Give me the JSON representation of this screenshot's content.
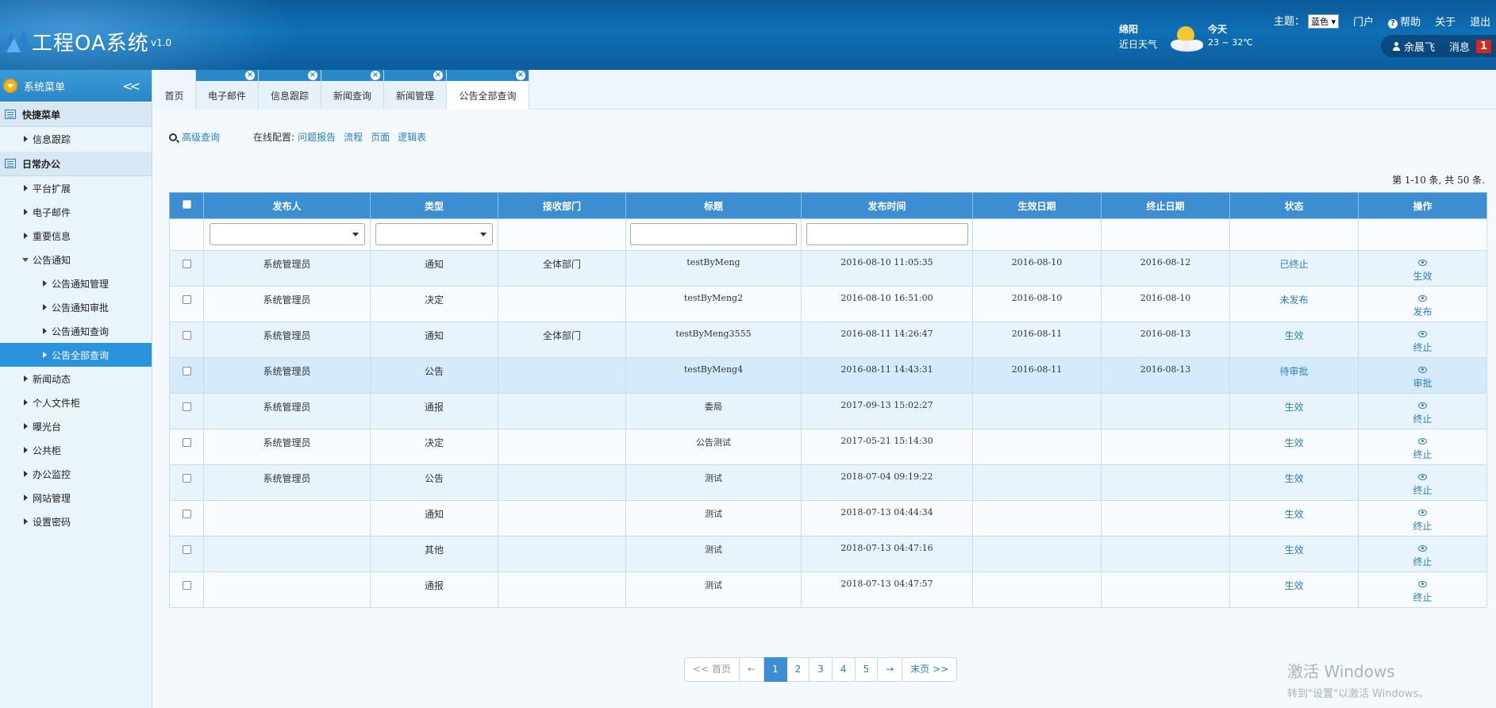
{
  "header": {
    "title": "工程OA系统",
    "version": "v1.0",
    "weather": {
      "city": "绵阳",
      "label": "近日天气",
      "today": "今天",
      "temp": "23 ~ 32℃"
    },
    "theme_label": "主题：",
    "theme_value": "蓝色",
    "nav": {
      "portal": "门户",
      "help": "帮助",
      "about": "关于",
      "logout": "退出"
    },
    "user": {
      "name": "余晨飞",
      "messages_label": "消息",
      "messages_count": "1"
    }
  },
  "sidebar": {
    "title": "系统菜单",
    "collapse": "<<",
    "sections": [
      {
        "label": "快捷菜单",
        "items": [
          {
            "label": "信息跟踪"
          }
        ]
      },
      {
        "label": "日常办公",
        "items": [
          {
            "label": "平台扩展"
          },
          {
            "label": "电子邮件"
          },
          {
            "label": "重要信息"
          },
          {
            "label": "公告通知",
            "expanded": true,
            "children": [
              {
                "label": "公告通知管理"
              },
              {
                "label": "公告通知审批"
              },
              {
                "label": "公告通知查询"
              },
              {
                "label": "公告全部查询",
                "active": true
              }
            ]
          },
          {
            "label": "新闻动态"
          },
          {
            "label": "个人文件柜"
          },
          {
            "label": "曝光台"
          },
          {
            "label": "公共柜"
          },
          {
            "label": "办公监控"
          },
          {
            "label": "网站管理"
          },
          {
            "label": "设置密码"
          }
        ]
      }
    ]
  },
  "tabs": [
    {
      "label": "首页",
      "closable": false
    },
    {
      "label": "电子邮件",
      "closable": true
    },
    {
      "label": "信息跟踪",
      "closable": true
    },
    {
      "label": "新闻查询",
      "closable": true
    },
    {
      "label": "新闻管理",
      "closable": true
    },
    {
      "label": "公告全部查询",
      "closable": true,
      "active": true
    }
  ],
  "toolbar": {
    "advanced_search": "高级查询",
    "online_config_label": "在线配置:",
    "config_links": [
      "问题报告",
      "流程",
      "页面",
      "逻辑表"
    ]
  },
  "count_text": "第 1-10 条, 共 50 条.",
  "table": {
    "columns": [
      "发布人",
      "类型",
      "接收部门",
      "标题",
      "发布时间",
      "生效日期",
      "终止日期",
      "状态",
      "操作"
    ],
    "rows": [
      {
        "publisher": "系统管理员",
        "type": "通知",
        "dept": "全体部门",
        "title": "testByMeng",
        "time": "2016-08-10 11:05:35",
        "start": "2016-08-10",
        "end": "2016-08-12",
        "status": "已终止",
        "action": "生效"
      },
      {
        "publisher": "系统管理员",
        "type": "决定",
        "dept": "",
        "title": "testByMeng2",
        "time": "2016-08-10 16:51:00",
        "start": "2016-08-10",
        "end": "2016-08-10",
        "status": "未发布",
        "action": "发布"
      },
      {
        "publisher": "系统管理员",
        "type": "通知",
        "dept": "全体部门",
        "title": "testByMeng3555",
        "time": "2016-08-11 14:26:47",
        "start": "2016-08-11",
        "end": "2016-08-13",
        "status": "生效",
        "action": "终止"
      },
      {
        "publisher": "系统管理员",
        "type": "公告",
        "dept": "",
        "title": "testByMeng4",
        "time": "2016-08-11 14:43:31",
        "start": "2016-08-11",
        "end": "2016-08-13",
        "status": "待审批",
        "action": "审批"
      },
      {
        "publisher": "系统管理员",
        "type": "通报",
        "dept": "",
        "title": "委局",
        "time": "2017-09-13 15:02:27",
        "start": "",
        "end": "",
        "status": "生效",
        "action": "终止"
      },
      {
        "publisher": "系统管理员",
        "type": "决定",
        "dept": "",
        "title": "公告测试",
        "time": "2017-05-21 15:14:30",
        "start": "",
        "end": "",
        "status": "生效",
        "action": "终止"
      },
      {
        "publisher": "系统管理员",
        "type": "公告",
        "dept": "",
        "title": "测试",
        "time": "2018-07-04 09:19:22",
        "start": "",
        "end": "",
        "status": "生效",
        "action": "终止"
      },
      {
        "publisher": "",
        "type": "通知",
        "dept": "",
        "title": "测试",
        "time": "2018-07-13 04:44:34",
        "start": "",
        "end": "",
        "status": "生效",
        "action": "终止"
      },
      {
        "publisher": "",
        "type": "其他",
        "dept": "",
        "title": "测试",
        "time": "2018-07-13 04:47:16",
        "start": "",
        "end": "",
        "status": "生效",
        "action": "终止"
      },
      {
        "publisher": "",
        "type": "通报",
        "dept": "",
        "title": "测试",
        "time": "2018-07-13 04:47:57",
        "start": "",
        "end": "",
        "status": "生效",
        "action": "终止"
      }
    ]
  },
  "pager": {
    "first": "<< 首页",
    "prev": "←",
    "pages": [
      "1",
      "2",
      "3",
      "4",
      "5"
    ],
    "current": "1",
    "next": "→",
    "last": "末页 >>"
  },
  "watermark": {
    "line1": "激活 Windows",
    "line2": "转到\"设置\"以激活 Windows。"
  }
}
